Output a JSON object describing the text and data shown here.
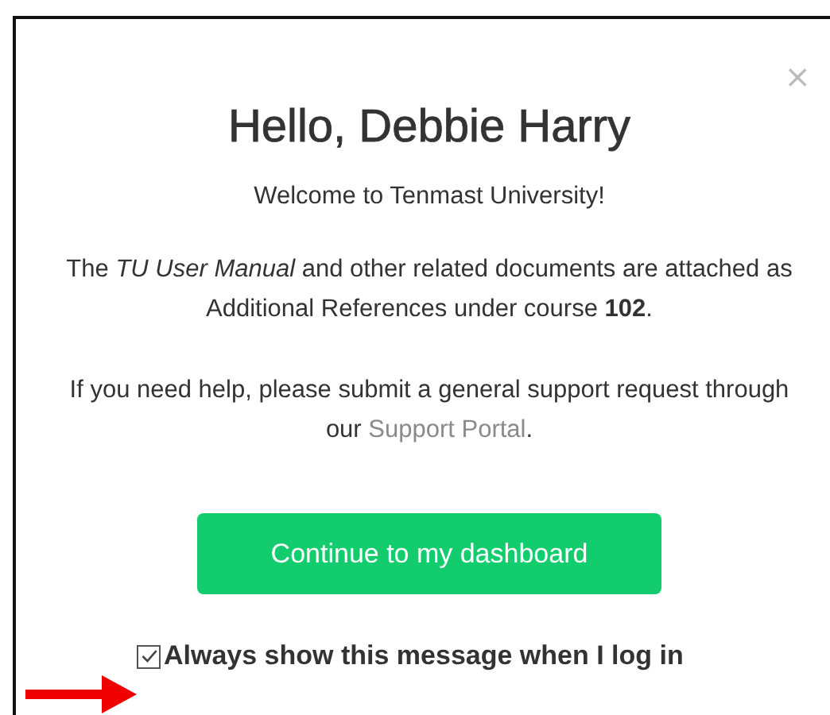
{
  "dialog": {
    "close": "×",
    "title": "Hello, Debbie Harry",
    "welcome": "Welcome to Tenmast University!",
    "manual_text": "The *TU User Manual* and other related documents are attached as Additional References under course **102**.",
    "help_text_before": "If you need help, please submit a general support request through our",
    "help_link": "Support Portal",
    "help_text_after": ".",
    "continue_button": "Continue to my dashboard",
    "always_show": {
      "label": "Always show this message when I log in",
      "checked": true
    }
  }
}
